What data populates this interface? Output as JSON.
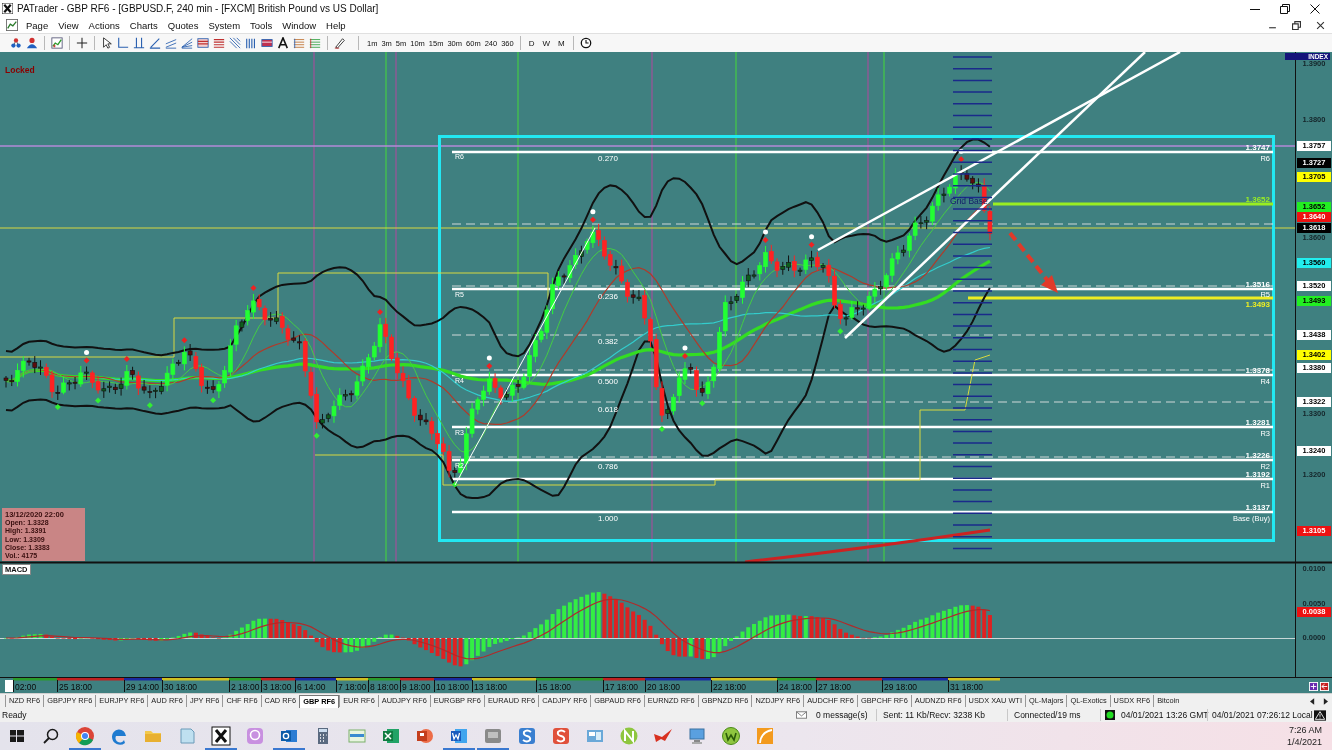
{
  "window": {
    "title": "PATrader - GBP RF6 - [GBPUSD.F, 240 min - [FXCM] British Pound vs US Dollar]"
  },
  "menu": {
    "items": [
      "Page",
      "View",
      "Actions",
      "Charts",
      "Quotes",
      "System",
      "Tools",
      "Window",
      "Help"
    ]
  },
  "toolbar": {
    "timeframes": [
      "1m",
      "3m",
      "5m",
      "10m",
      "15m",
      "30m",
      "60m",
      "240",
      "360"
    ],
    "periods": [
      "D",
      "W",
      "M"
    ]
  },
  "chart": {
    "lock_label": "Locked",
    "index_tag": "INDEX",
    "grid_label": "Grid Base",
    "price_labels": [
      {
        "text": "1.3900",
        "kind": "tick"
      },
      {
        "text": "1.3800",
        "kind": "tick"
      },
      {
        "text": "1.3757",
        "kind": "tag",
        "color": "#ffffff"
      },
      {
        "text": "1.3727",
        "kind": "tag",
        "color": "#000000"
      },
      {
        "text": "1.3705",
        "kind": "tag",
        "color": "#ffff00"
      },
      {
        "text": "1.3652",
        "kind": "tag",
        "color": "#22ee22"
      },
      {
        "text": "1.3640",
        "kind": "tag",
        "color": "#ee1111"
      },
      {
        "text": "1.3618",
        "kind": "tag",
        "color": "#000000"
      },
      {
        "text": "1.3600",
        "kind": "tick"
      },
      {
        "text": "1.3560",
        "kind": "tag",
        "color": "#22eeee"
      },
      {
        "text": "1.3520",
        "kind": "tag",
        "color": "#ffffff"
      },
      {
        "text": "1.3493",
        "kind": "tag",
        "color": "#22ee22"
      },
      {
        "text": "1.3438",
        "kind": "tag",
        "color": "#ffffff"
      },
      {
        "text": "1.3402",
        "kind": "tag",
        "color": "#ffff00"
      },
      {
        "text": "1.3380",
        "kind": "tag",
        "color": "#ffffff"
      },
      {
        "text": "1.3322",
        "kind": "tag",
        "color": "#ffffff"
      },
      {
        "text": "1.3300",
        "kind": "tick"
      },
      {
        "text": "1.3240",
        "kind": "tag",
        "color": "#ffffff"
      },
      {
        "text": "1.3200",
        "kind": "tick"
      },
      {
        "text": "1.3105",
        "kind": "tag",
        "color": "#ee1111"
      }
    ],
    "fib_labels": [
      "0.270",
      "0.236",
      "0.382",
      "0.500",
      "0.618",
      "0.786",
      "1.000"
    ],
    "pivot_names": [
      "R6",
      "R5",
      "R4",
      "R3",
      "R2"
    ],
    "level_labels": [
      {
        "value": "1.3747",
        "name": "R6",
        "color": "#ffffff"
      },
      {
        "value": "1.3652",
        "color": "#99ee22"
      },
      {
        "value": "1.3516",
        "name": "R5",
        "color": "#ffffff"
      },
      {
        "value": "1.3493",
        "color": "#eeee22"
      },
      {
        "value": "1.3378",
        "name": "R4",
        "color": "#ffffff"
      },
      {
        "value": "1.3281",
        "name": "R3",
        "color": "#ffffff"
      },
      {
        "value": "1.3226",
        "name": "R2",
        "color": "#ffffff"
      },
      {
        "value": "1.3192",
        "name": "R1",
        "color": "#ffffff"
      },
      {
        "value": "1.3137",
        "name": "Base (Buy)",
        "color": "#ffffff"
      }
    ],
    "info_box": {
      "title": "13/12/2020 22:00",
      "lines": [
        "Open: 1.3328",
        "High: 1.3391",
        "Low: 1.3309",
        "Close: 1.3383",
        "Vol.: 4175"
      ]
    }
  },
  "macd": {
    "title": "MACD",
    "axis_labels": [
      "0.0100",
      "0.0050",
      "0.0000"
    ],
    "tags": [
      {
        "text": "0.0038",
        "color": "#ee1111"
      }
    ]
  },
  "time_axis": {
    "labels": [
      "02:00",
      "25 18:00",
      "29 14:00",
      "30 18:00",
      "2 18:00",
      "3 18:00",
      "6 14:00",
      "7 18:00",
      "8 18:00",
      "9 18:00",
      "10 18:00",
      "13 18:00",
      "15 18:00",
      "17 18:00",
      "20 18:00",
      "22 18:00",
      "24 18:00",
      "27 18:00",
      "29 18:00",
      "31 18:00"
    ]
  },
  "tabs": [
    {
      "label": "NZD RF6",
      "selected": false
    },
    {
      "label": "GBPJPY RF6",
      "selected": false
    },
    {
      "label": "EURJPY RF6",
      "selected": false
    },
    {
      "label": "AUD RF6",
      "selected": false
    },
    {
      "label": "JPY RF6",
      "selected": false
    },
    {
      "label": "CHF RF6",
      "selected": false
    },
    {
      "label": "CAD RF6",
      "selected": false
    },
    {
      "label": "GBP RF6",
      "selected": true
    },
    {
      "label": "EUR RF6",
      "selected": false
    },
    {
      "label": "AUDJPY RF6",
      "selected": false
    },
    {
      "label": "EURGBP RF6",
      "selected": false
    },
    {
      "label": "EURAUD RF6",
      "selected": false
    },
    {
      "label": "CADJPY RF6",
      "selected": false
    },
    {
      "label": "GBPAUD RF6",
      "selected": false
    },
    {
      "label": "EURNZD RF6",
      "selected": false
    },
    {
      "label": "GBPNZD RF6",
      "selected": false
    },
    {
      "label": "NZDJPY RF6",
      "selected": false
    },
    {
      "label": "AUDCHF RF6",
      "selected": false
    },
    {
      "label": "GBPCHF RF6",
      "selected": false
    },
    {
      "label": "AUDNZD RF6",
      "selected": false
    },
    {
      "label": "USDX XAU WTI",
      "selected": false
    },
    {
      "label": "QL-Majors",
      "selected": false
    },
    {
      "label": "QL-Exotics",
      "selected": false
    },
    {
      "label": "USDX RF6",
      "selected": false
    },
    {
      "label": "Bitcoin",
      "selected": false
    }
  ],
  "status_bar": {
    "state": "Ready",
    "messages": "0 message(s)",
    "traffic": "Sent: 11 Kb/Recv: 3238 Kb",
    "connection": "Connected/19 ms",
    "gmt_time": "04/01/2021 13:26 GMT",
    "local_time": "04/01/2021 07:26:12 Local"
  },
  "taskbar": {
    "apps": [
      {
        "running": true
      },
      {
        "running": false
      },
      {
        "running": false
      },
      {
        "running": false
      },
      {
        "running": true
      },
      {
        "running": false
      },
      {
        "running": true
      },
      {
        "running": false
      },
      {
        "running": false
      },
      {
        "running": false
      },
      {
        "running": false
      },
      {
        "running": true
      },
      {
        "running": true
      },
      {
        "running": false
      },
      {
        "running": false
      },
      {
        "running": false
      },
      {
        "running": false
      },
      {
        "running": false
      },
      {
        "running": false
      },
      {
        "running": false
      },
      {
        "running": false
      }
    ],
    "time": "7:26 AM",
    "date": "1/4/2021"
  }
}
